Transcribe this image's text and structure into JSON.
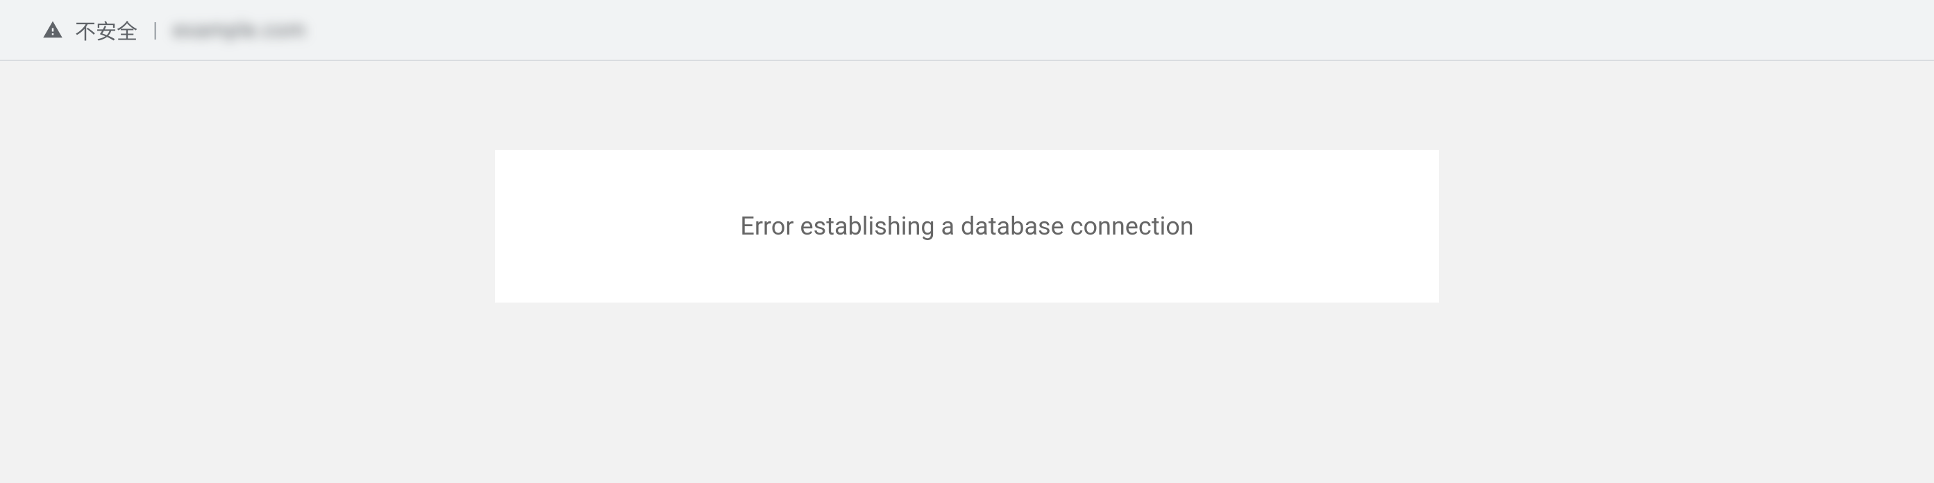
{
  "addressBar": {
    "securityLabel": "不安全",
    "divider": "|",
    "urlObscured": "example.com"
  },
  "page": {
    "errorMessage": "Error establishing a database connection"
  }
}
